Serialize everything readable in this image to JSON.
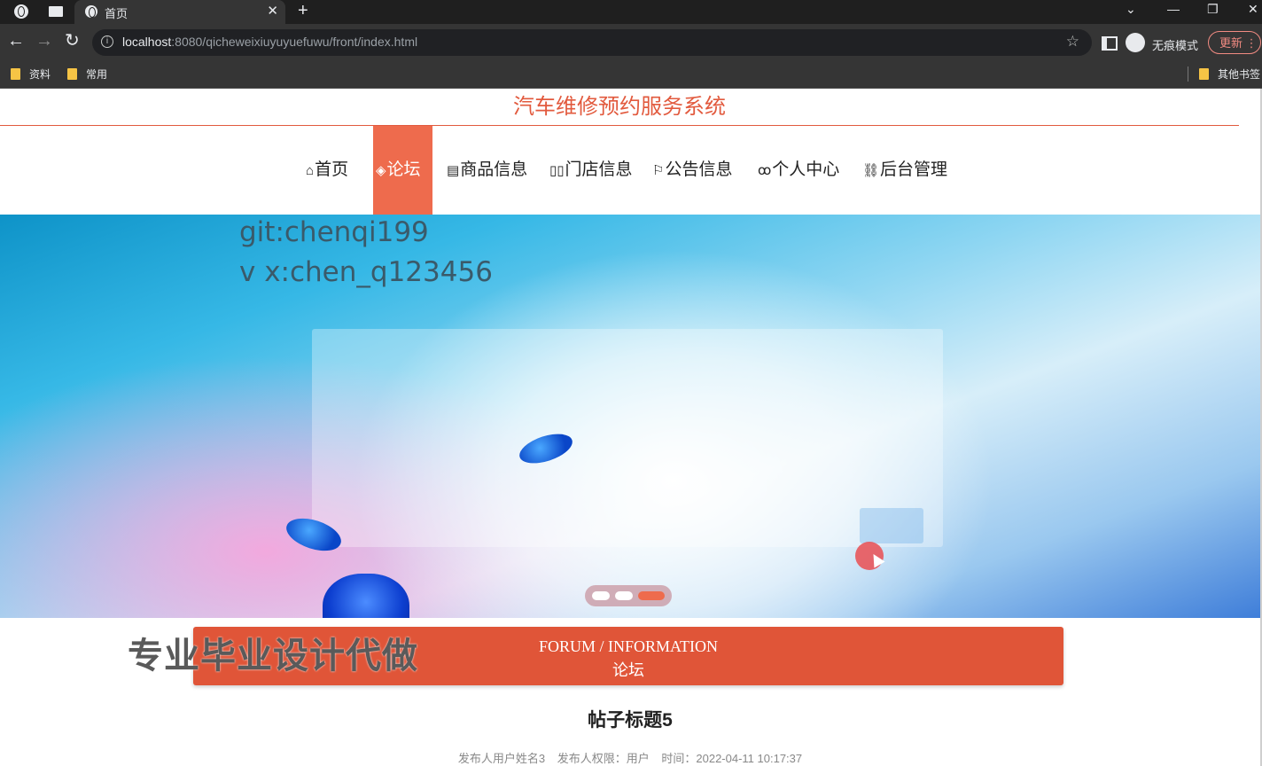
{
  "browser": {
    "tab_title": "首页",
    "new_tab_symbol": "+",
    "url_host": "localhost",
    "url_rest": ":8080/qicheweixiuyuyuefuwu/front/index.html",
    "incognito_label": "无痕模式",
    "update_label": "更新",
    "bookmarks": [
      "资料",
      "常用"
    ],
    "other_bookmarks": "其他书签"
  },
  "site": {
    "title": "汽车维修预约服务系统"
  },
  "nav": {
    "items": [
      {
        "icon": "⌂",
        "label": "首页"
      },
      {
        "icon": "◈",
        "label": "论坛"
      },
      {
        "icon": "▤",
        "label": "商品信息"
      },
      {
        "icon": "▯▯",
        "label": "门店信息"
      },
      {
        "icon": "⚐",
        "label": "公告信息"
      },
      {
        "icon": "ꝏ",
        "label": "个人中心"
      },
      {
        "icon": "⛓",
        "label": "后台管理"
      }
    ],
    "active_index": 1
  },
  "banner": {
    "watermark_line1": "git:chenqi199",
    "watermark_line2": "v x:chen_q123456",
    "carousel_active_index": 2,
    "carousel_count": 3
  },
  "overlay_ad": "专业毕业设计代做",
  "section": {
    "title_en": "FORUM / INFORMATION",
    "title_cn": "论坛"
  },
  "post": {
    "title": "帖子标题5",
    "author": "发布人用户姓名3",
    "role": "发布人权限：用户",
    "time": "时间：2022-04-11 10:17:37"
  },
  "colors": {
    "accent": "#ee6b4d",
    "section_bar": "#e05538",
    "title_red": "#e25a3e"
  }
}
